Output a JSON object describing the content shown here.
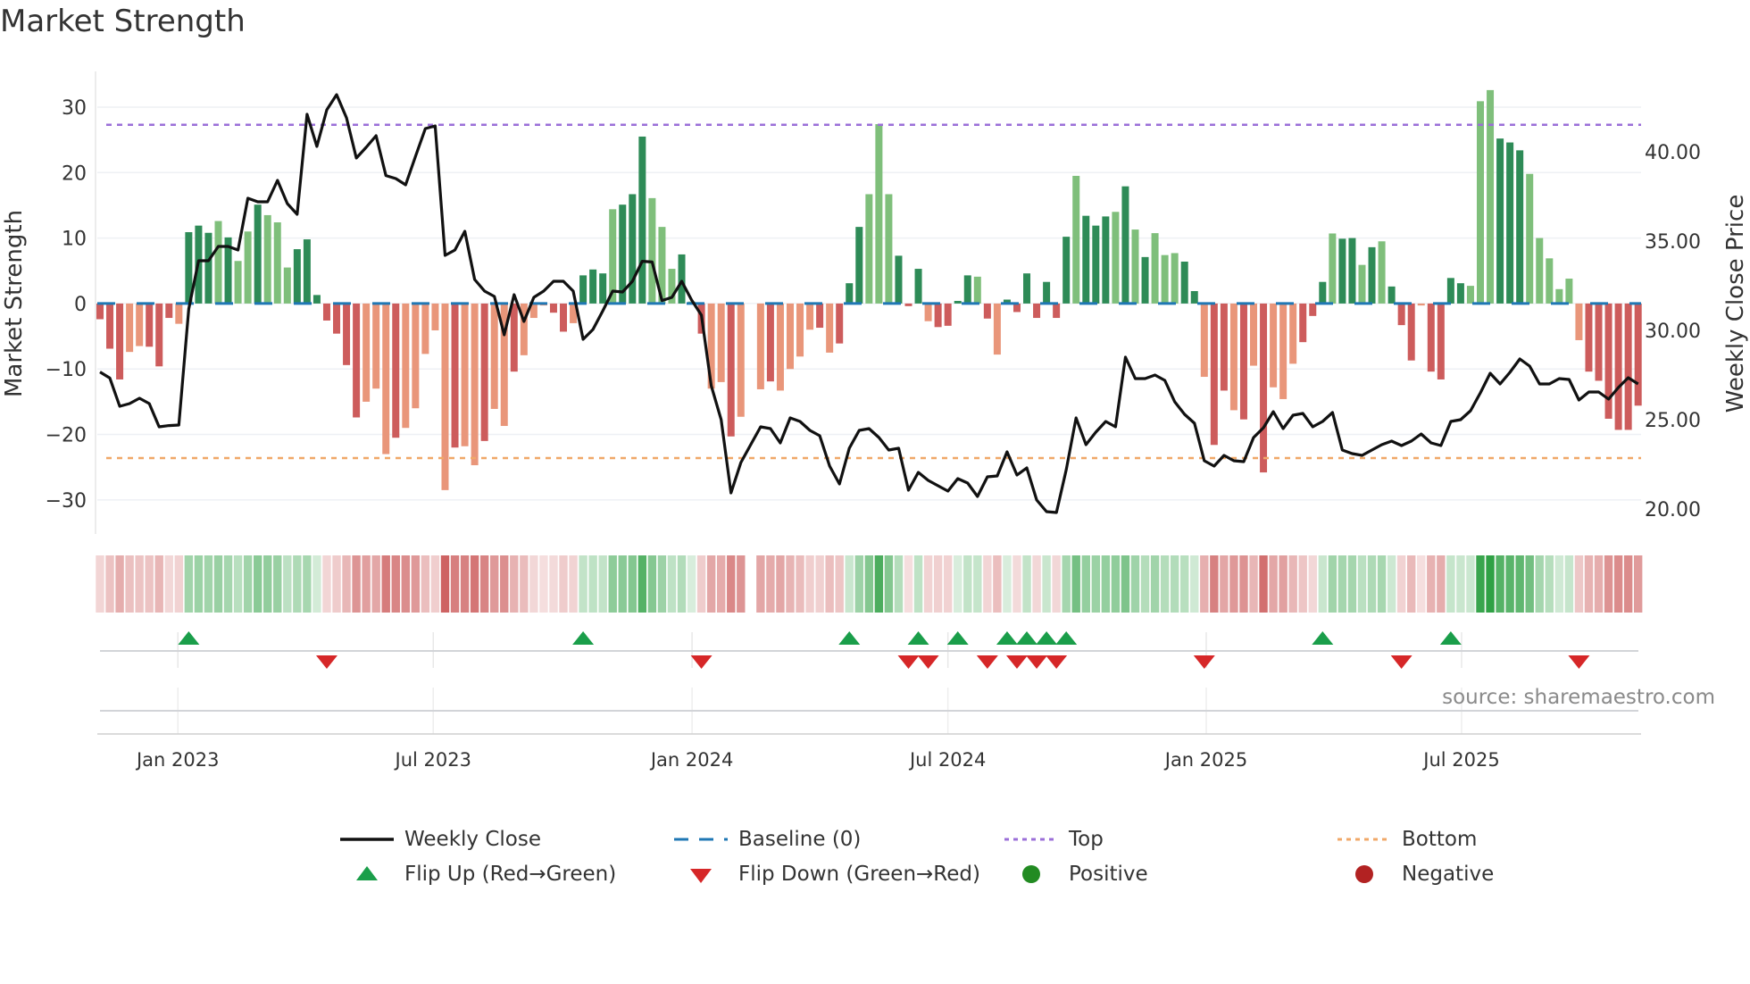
{
  "title": "Market Strength",
  "source": "source: sharemaestro.com",
  "colors": {
    "pos_dark": "#2e8b57",
    "pos_light": "#7fbf7b",
    "neg_dark": "#cd5c5c",
    "neg_light": "#e9967a",
    "top": "#9b6fd8",
    "bottom": "#f0a868",
    "baseline": "#1f77b4",
    "flip_up": "#1a9e4a",
    "flip_down": "#d62728",
    "positive": "#228b22",
    "negative": "#b22222",
    "strip_pos": "46,160,67",
    "strip_neg": "200,80,80"
  },
  "legend": {
    "weekly_close": "Weekly Close",
    "baseline": "Baseline (0)",
    "top": "Top",
    "bottom": "Bottom",
    "flip_up": "Flip Up (Red→Green)",
    "flip_down": "Flip Down (Green→Red)",
    "positive": "Positive",
    "negative": "Negative"
  },
  "chart_data": {
    "type": "bar",
    "title": "Market Strength",
    "ylabel": "Market Strength",
    "y2label": "Weekly Close Price",
    "ylim": [
      -35.2,
      35.45
    ],
    "y2lim": [
      18.6,
      44.5
    ],
    "xlim": [
      -0.27,
      156.3
    ],
    "yticks": [
      30,
      20,
      10,
      0,
      -10,
      -20,
      -30
    ],
    "ytick_labels": [
      "30",
      "20",
      "10",
      "0",
      "−10",
      "−20",
      "−30"
    ],
    "y2ticks": [
      40,
      35,
      30,
      25,
      20
    ],
    "y2tick_labels": [
      "40.00",
      "35.00",
      "30.00",
      "25.00",
      "20.00"
    ],
    "xticks": [
      7.9,
      33.8,
      60.05,
      86.0,
      112.2,
      138.1
    ],
    "xtick_labels": [
      "Jan 2023",
      "Jul 2023",
      "Jan 2024",
      "Jul 2024",
      "Jan 2025",
      "Jul 2025"
    ],
    "top_level": 27.3,
    "bottom_level": -23.6,
    "baseline": 0,
    "strength": [
      -2.4,
      -6.9,
      -11.6,
      -7.4,
      -6.5,
      -6.6,
      -9.6,
      -2.2,
      -3.1,
      10.9,
      11.9,
      10.8,
      12.6,
      10.1,
      6.5,
      11.0,
      15.1,
      13.5,
      12.4,
      5.5,
      8.3,
      9.8,
      1.3,
      -2.6,
      -4.6,
      -9.4,
      -17.4,
      -15,
      -13,
      -23,
      -20.5,
      -19,
      -16,
      -7.7,
      -4.1,
      -28.5,
      -22,
      -21.8,
      -24.7,
      -21,
      -16.1,
      -18.7,
      -10.4,
      -7.9,
      -2.2,
      -0.3,
      -1.4,
      -4.3,
      -3.0,
      4.3,
      5.2,
      4.6,
      14.4,
      15.1,
      16.7,
      25.5,
      16.1,
      11.7,
      5.3,
      7.5,
      0.3,
      -4.6,
      -13,
      -12,
      -20.3,
      -17.3,
      null,
      -13.1,
      -11.9,
      -13.3,
      -10,
      -8.1,
      -4.0,
      -3.7,
      -7.5,
      -6.1,
      3.1,
      11.7,
      16.7,
      27.4,
      16.7,
      7.3,
      -0.4,
      5.3,
      -2.7,
      -3.6,
      -3.4,
      0.4,
      4.3,
      4.1,
      -2.3,
      -7.8,
      0.6,
      -1.3,
      4.6,
      -2.2,
      3.3,
      -2.2,
      10.2,
      19.5,
      13.4,
      11.9,
      13.3,
      14.0,
      17.9,
      11.3,
      7.1,
      10.75,
      7.4,
      7.7,
      6.4,
      1.9,
      -11.2,
      -21.6,
      -13.3,
      -16.3,
      -17.7,
      -9.5,
      -25.8,
      -12.8,
      -14.6,
      -9.2,
      -5.9,
      -1.9,
      3.3,
      10.7,
      9.9,
      10.0,
      5.9,
      8.6,
      9.5,
      2.6,
      -3.3,
      -8.7,
      -0.3,
      -10.4,
      -11.6,
      3.9,
      3.1,
      2.7,
      30.9,
      32.6,
      25.2,
      24.6,
      23.4,
      19.8,
      10.0,
      6.9,
      2.2,
      3.8,
      -5.6,
      -10.4,
      -11.8,
      -17.6,
      -19.3,
      -19.3,
      -15.6
    ],
    "shade": "dddlldddldddldlldllldddddddllldllllldlldlldlllddldddldddllldldlldllldlllldldddllldddlddddldldddddddldddldldlllddlddldldllldddlddldldddlddddllldddllllllddddddddll",
    "weekly_close": [
      27.67,
      27.33,
      25.75,
      25.9,
      26.2,
      25.9,
      24.6,
      24.67,
      24.7,
      31.2,
      33.9,
      33.9,
      34.7,
      34.7,
      34.5,
      37.4,
      37.2,
      37.2,
      38.4,
      37.1,
      36.5,
      42.1,
      40.3,
      42.35,
      43.2,
      41.9,
      39.65,
      40.25,
      40.9,
      38.67,
      38.5,
      38.15,
      39.75,
      41.3,
      41.45,
      34.2,
      34.5,
      35.55,
      32.85,
      32.2,
      31.9,
      29.75,
      32.0,
      30.5,
      31.85,
      32.2,
      32.75,
      32.75,
      32.2,
      29.5,
      30.05,
      31.1,
      32.2,
      32.15,
      32.75,
      33.87,
      33.83,
      31.67,
      31.85,
      32.75,
      31.7,
      30.85,
      26.9,
      25.0,
      20.9,
      22.6,
      23.6,
      24.6,
      24.5,
      23.7,
      25.1,
      24.9,
      24.4,
      24.1,
      22.4,
      21.4,
      23.4,
      24.4,
      24.5,
      24.0,
      23.3,
      23.4,
      21.05,
      22.05,
      21.6,
      21.3,
      21.0,
      21.7,
      21.45,
      20.7,
      21.8,
      21.85,
      23.2,
      21.9,
      22.3,
      20.5,
      19.85,
      19.8,
      22.2,
      25.1,
      23.6,
      24.3,
      24.9,
      24.6,
      28.5,
      27.3,
      27.3,
      27.5,
      27.2,
      26.0,
      25.3,
      24.8,
      22.7,
      22.4,
      23.0,
      22.7,
      22.65,
      24.0,
      24.55,
      25.45,
      24.5,
      25.25,
      25.35,
      24.6,
      24.9,
      25.4,
      23.3,
      23.1,
      23.0,
      23.3,
      23.6,
      23.8,
      23.55,
      23.8,
      24.2,
      23.7,
      23.55,
      24.9,
      25.0,
      25.5,
      26.5,
      27.6,
      27.0,
      27.65,
      28.4,
      28.0,
      27.0,
      27.0,
      27.3,
      27.25,
      26.1,
      26.55,
      26.55,
      26.15,
      26.8,
      27.35,
      27.0
    ],
    "strength_max_abs": 33
  }
}
